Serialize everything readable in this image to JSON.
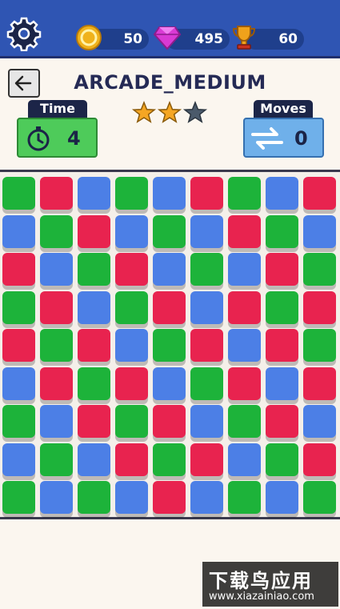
{
  "header": {
    "coins": "50",
    "gems": "495",
    "trophies": "60"
  },
  "level": {
    "title": "ARCADE_MEDIUM",
    "stars_earned": 2,
    "stars_total": 3
  },
  "stats": {
    "time_label": "Time",
    "time_value": "4",
    "moves_label": "Moves",
    "moves_value": "0"
  },
  "board": {
    "rows": [
      [
        "green",
        "red",
        "blue",
        "green",
        "blue",
        "red",
        "green",
        "blue",
        "red"
      ],
      [
        "blue",
        "green",
        "red",
        "blue",
        "green",
        "blue",
        "red",
        "green",
        "blue"
      ],
      [
        "red",
        "blue",
        "green",
        "red",
        "blue",
        "green",
        "blue",
        "red",
        "green"
      ],
      [
        "green",
        "red",
        "blue",
        "green",
        "red",
        "blue",
        "red",
        "green",
        "red"
      ],
      [
        "red",
        "green",
        "red",
        "blue",
        "green",
        "red",
        "blue",
        "red",
        "green"
      ],
      [
        "blue",
        "red",
        "green",
        "red",
        "blue",
        "green",
        "red",
        "blue",
        "red"
      ],
      [
        "green",
        "blue",
        "red",
        "green",
        "red",
        "blue",
        "green",
        "red",
        "blue"
      ],
      [
        "blue",
        "green",
        "blue",
        "red",
        "green",
        "red",
        "blue",
        "green",
        "red"
      ],
      [
        "green",
        "blue",
        "green",
        "blue",
        "red",
        "blue",
        "green",
        "blue",
        "green"
      ]
    ]
  },
  "watermark": {
    "line1": "下载鸟应用",
    "line2": "www.xiazainiao.com"
  },
  "colors": {
    "header_bg": "#2f55b3",
    "green": "#1db33a",
    "red": "#e8234f",
    "blue": "#4c7fe6",
    "star_gold": "#f5a623",
    "star_empty": "#4b5a6b"
  }
}
